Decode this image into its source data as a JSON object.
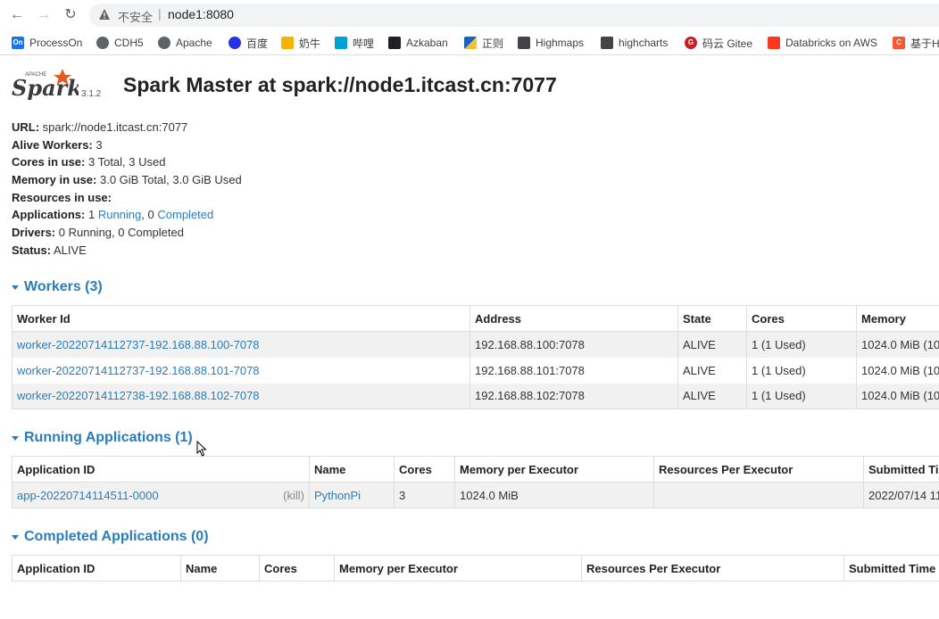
{
  "browser": {
    "insecure_label": "不安全",
    "url": "node1:8080",
    "bookmarks": [
      {
        "label": "ProcessOn",
        "icon": "processon-icon",
        "mark": "On",
        "color": "#1a73e8"
      },
      {
        "label": "CDH5",
        "icon": "globe-icon",
        "mark": "",
        "color": "#5f6368"
      },
      {
        "label": "Apache",
        "icon": "globe-icon",
        "mark": "",
        "color": "#5f6368"
      },
      {
        "label": "百度",
        "icon": "baidu-icon",
        "mark": "",
        "color": "#2932e1"
      },
      {
        "label": "奶牛",
        "icon": "cow-icon",
        "mark": "",
        "color": "#f4b400"
      },
      {
        "label": "哔哩",
        "icon": "bilibili-icon",
        "mark": "",
        "color": "#00a1d6"
      },
      {
        "label": "Azkaban",
        "icon": "azkaban-icon",
        "mark": "",
        "color": "#202124"
      },
      {
        "label": "正则",
        "icon": "regex-icon",
        "mark": "",
        "color": "#1565c0"
      },
      {
        "label": "Highmaps",
        "icon": "highcharts-icon",
        "mark": "",
        "color": "#434348"
      },
      {
        "label": "highcharts",
        "icon": "highcharts-icon",
        "mark": "",
        "color": "#434348"
      },
      {
        "label": "码云 Gitee",
        "icon": "gitee-icon",
        "mark": "G",
        "color": "#c71d23"
      },
      {
        "label": "Databricks on AWS",
        "icon": "databricks-icon",
        "mark": "",
        "color": "#ff3621"
      },
      {
        "label": "基于H",
        "icon": "csdn-icon",
        "mark": "C",
        "color": "#fc5531"
      }
    ]
  },
  "header": {
    "logo_text": "Spark",
    "logo_sub": "APACHE",
    "version": "3.1.2",
    "title": "Spark Master at spark://node1.itcast.cn:7077"
  },
  "summary": {
    "url_label": "URL:",
    "url_value": "spark://node1.itcast.cn:7077",
    "alive_label": "Alive Workers:",
    "alive_value": "3",
    "cores_label": "Cores in use:",
    "cores_value": "3 Total, 3 Used",
    "memory_label": "Memory in use:",
    "memory_value": "3.0 GiB Total, 3.0 GiB Used",
    "resources_label": "Resources in use:",
    "apps_label": "Applications:",
    "apps_running_count": "1",
    "apps_running_link": "Running",
    "apps_sep": ",",
    "apps_completed_count": "0",
    "apps_completed_link": "Completed",
    "drivers_label": "Drivers:",
    "drivers_value": "0 Running, 0 Completed",
    "status_label": "Status:",
    "status_value": "ALIVE"
  },
  "workers": {
    "heading": "Workers (3)",
    "columns": [
      "Worker Id",
      "Address",
      "State",
      "Cores",
      "Memory"
    ],
    "rows": [
      {
        "id": "worker-20220714112737-192.168.88.100-7078",
        "address": "192.168.88.100:7078",
        "state": "ALIVE",
        "cores": "1 (1 Used)",
        "memory": "1024.0 MiB (10"
      },
      {
        "id": "worker-20220714112737-192.168.88.101-7078",
        "address": "192.168.88.101:7078",
        "state": "ALIVE",
        "cores": "1 (1 Used)",
        "memory": "1024.0 MiB (10"
      },
      {
        "id": "worker-20220714112738-192.168.88.102-7078",
        "address": "192.168.88.102:7078",
        "state": "ALIVE",
        "cores": "1 (1 Used)",
        "memory": "1024.0 MiB (10"
      }
    ]
  },
  "running": {
    "heading": "Running Applications (1)",
    "columns": [
      "Application ID",
      "Name",
      "Cores",
      "Memory per Executor",
      "Resources Per Executor",
      "Submitted Tir"
    ],
    "rows": [
      {
        "id": "app-20220714114511-0000",
        "kill": "(kill)",
        "name": "PythonPi",
        "cores": "3",
        "memory": "1024.0 MiB",
        "resources": "",
        "submitted": "2022/07/14 11"
      }
    ]
  },
  "completed": {
    "heading": "Completed Applications (0)",
    "columns": [
      "Application ID",
      "Name",
      "Cores",
      "Memory per Executor",
      "Resources Per Executor",
      "Submitted Time"
    ]
  }
}
